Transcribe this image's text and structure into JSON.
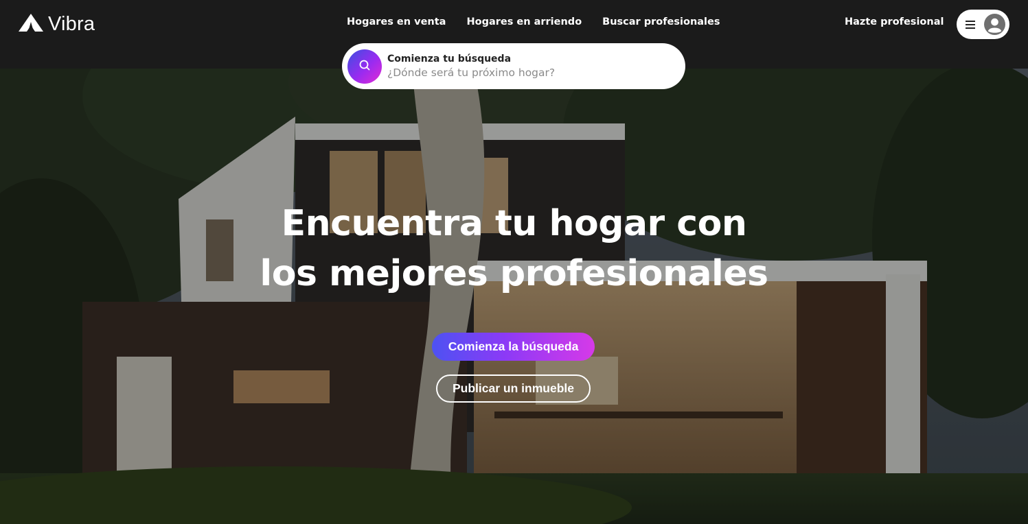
{
  "brand": {
    "name": "Vibra",
    "logo_icon": "vibra-logo-icon"
  },
  "nav": {
    "items": [
      {
        "label": "Hogares en venta"
      },
      {
        "label": "Hogares en arriendo"
      },
      {
        "label": "Buscar profesionales"
      }
    ],
    "become_pro": "Hazte profesional",
    "menu_icon": "hamburger-icon",
    "avatar_icon": "user-avatar-icon"
  },
  "search": {
    "title": "Comienza tu búsqueda",
    "placeholder": "¿Dónde será tu próximo hogar?",
    "icon": "search-icon"
  },
  "hero": {
    "title_line1": "Encuentra tu hogar con",
    "title_line2": "los mejores profesionales",
    "primary_button": "Comienza la búsqueda",
    "secondary_button": "Publicar un inmueble"
  },
  "colors": {
    "header_bg": "#1b1b1b",
    "gradient_start": "#4d52f2",
    "gradient_mid": "#8c3af6",
    "gradient_end": "#d63ae8"
  }
}
